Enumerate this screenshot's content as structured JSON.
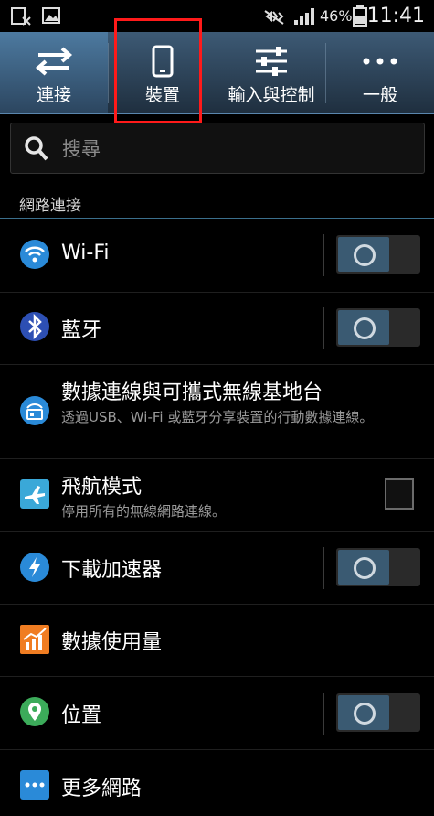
{
  "status_bar": {
    "battery": "46%",
    "time": "11:41"
  },
  "tabs": [
    {
      "label": "連接",
      "icon": "swap-arrows-icon",
      "active": true
    },
    {
      "label": "裝置",
      "icon": "phone-device-icon",
      "active": false
    },
    {
      "label": "輸入與控制",
      "icon": "sliders-icon",
      "active": false
    },
    {
      "label": "一般",
      "icon": "more-dots-icon",
      "active": false
    }
  ],
  "search": {
    "placeholder": "搜尋"
  },
  "section": {
    "title": "網路連接"
  },
  "items": [
    {
      "title": "Wi-Fi",
      "icon": "wifi-icon",
      "control": "toggle"
    },
    {
      "title": "藍牙",
      "icon": "bluetooth-icon",
      "control": "toggle"
    },
    {
      "title": "數據連線與可攜式無線基地台",
      "subtitle": "透過USB、Wi-Fi 或藍牙分享裝置的行動數據連線。",
      "icon": "hotspot-icon",
      "control": "none"
    },
    {
      "title": "飛航模式",
      "subtitle": "停用所有的無線網路連線。",
      "icon": "airplane-icon",
      "control": "checkbox"
    },
    {
      "title": "下載加速器",
      "icon": "download-booster-icon",
      "control": "toggle"
    },
    {
      "title": "數據使用量",
      "icon": "data-usage-icon",
      "control": "none"
    },
    {
      "title": "位置",
      "icon": "location-icon",
      "control": "toggle"
    },
    {
      "title": "更多網路",
      "icon": "more-networks-icon",
      "control": "none"
    }
  ],
  "colors": {
    "tab_bar": "#2b4257",
    "highlight_box": "#ff1a1a",
    "toggle_knob": "#3a5a72",
    "icon_blue": "#2a8ad8",
    "icon_orange": "#f07d22",
    "icon_green": "#3cab5a"
  }
}
